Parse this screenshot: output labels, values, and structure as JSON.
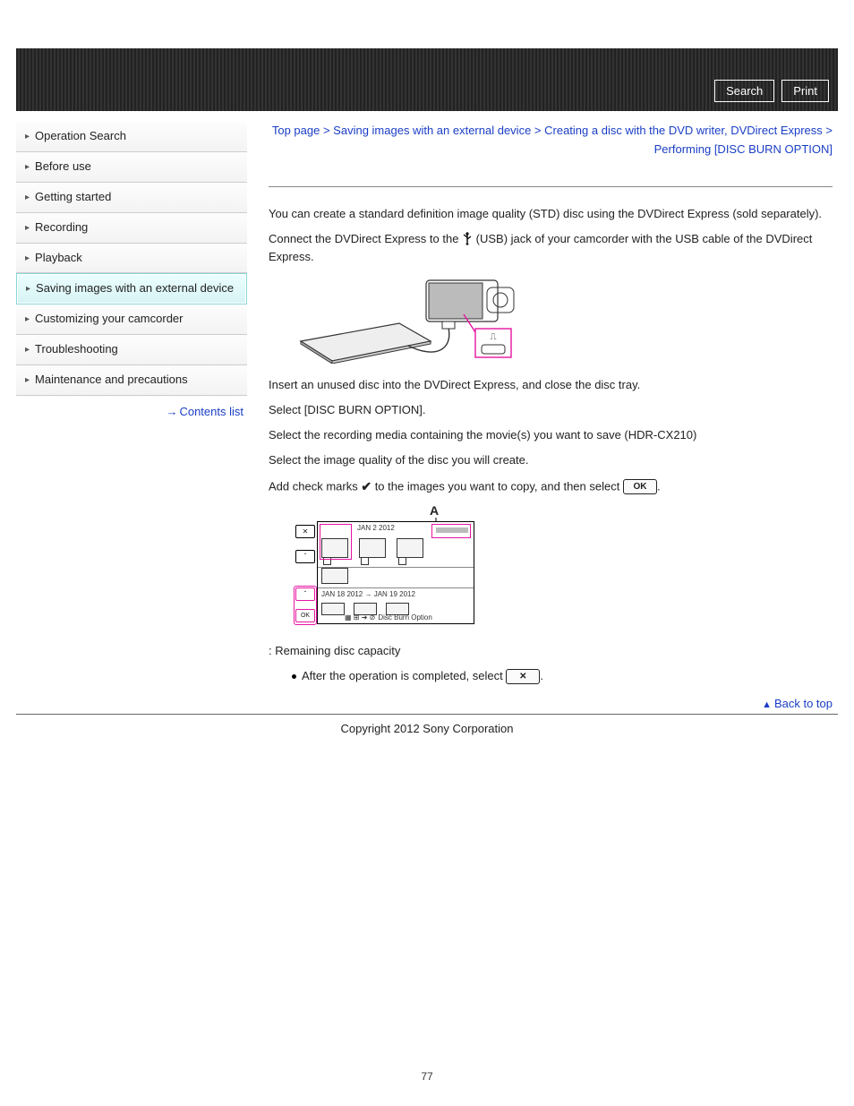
{
  "header": {
    "search_label": "Search",
    "print_label": "Print"
  },
  "sidebar": {
    "items": [
      {
        "label": "Operation Search"
      },
      {
        "label": "Before use"
      },
      {
        "label": "Getting started"
      },
      {
        "label": "Recording"
      },
      {
        "label": "Playback"
      },
      {
        "label": "Saving images with an external device"
      },
      {
        "label": "Customizing your camcorder"
      },
      {
        "label": "Troubleshooting"
      },
      {
        "label": "Maintenance and precautions"
      }
    ],
    "contents_list_label": "Contents list"
  },
  "breadcrumb": {
    "seg1": "Top page",
    "seg2": "Saving images with an external device",
    "seg3": "Creating a disc with the DVD writer, DVDirect Express",
    "seg4": "Performing [DISC BURN OPTION]",
    "sep": " > "
  },
  "content": {
    "intro": "You can create a standard definition image quality (STD) disc using the DVDirect Express (sold separately).",
    "step_connect_a": "Connect the DVDirect Express to the ",
    "step_connect_b": " (USB) jack of your camcorder with the USB cable of the DVDirect Express.",
    "step_insert": "Insert an unused disc into the DVDirect Express, and close the disc tray.",
    "step_select_opt": "Select [DISC BURN OPTION].",
    "step_media": "Select the recording media containing the movie(s) you want to save (HDR-CX210)",
    "step_quality": "Select the image quality of the disc you will create.",
    "step_check_a": "Add check marks ",
    "step_check_b": " to the images you want to copy, and then select ",
    "fig_label_A": "A",
    "remaining": ": Remaining disk capacity",
    "remaining_txt": ": Remaining disc capacity",
    "bullet_complete_a": "After the operation is completed, select ",
    "ok_label": "OK",
    "x_label": "✕",
    "screen_date1": "JAN 2 2012",
    "screen_date2": "JAN 18 2012 → JAN 19 2012",
    "screen_caption": "Disc Burn Option"
  },
  "footer": {
    "back_to_top": "Back to top",
    "copyright": "Copyright 2012 Sony Corporation",
    "page_no": "77"
  }
}
